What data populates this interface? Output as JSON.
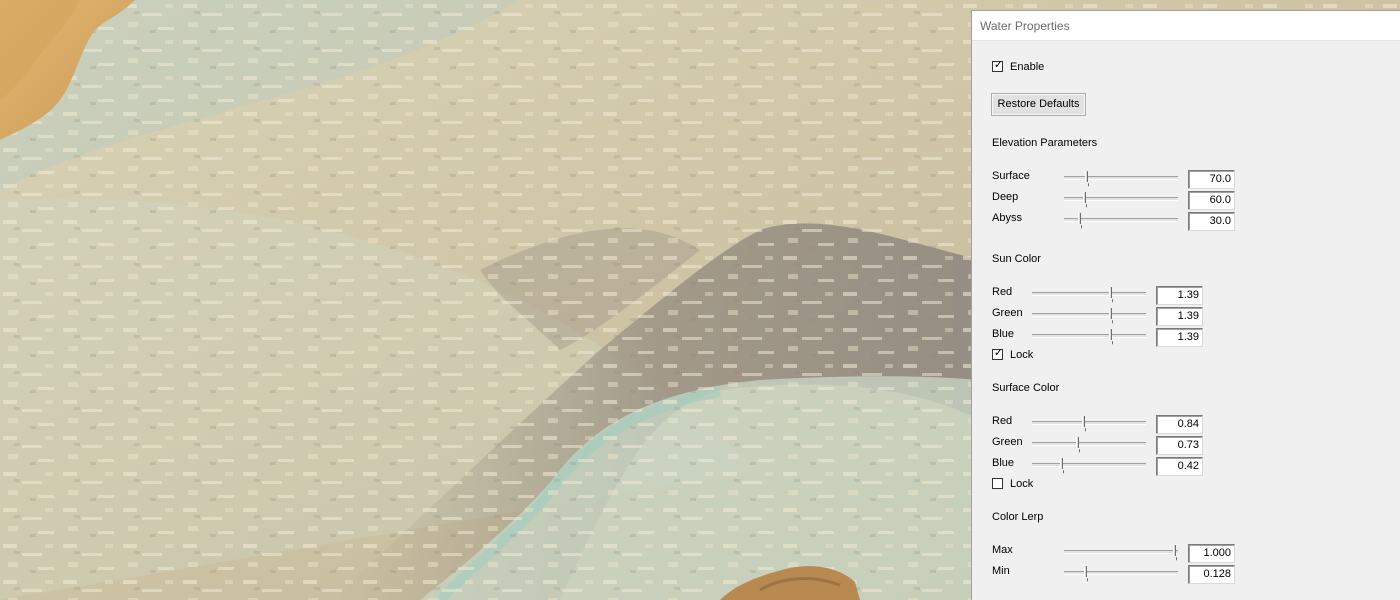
{
  "window": {
    "title": "Water Properties"
  },
  "enable": {
    "label": "Enable",
    "checked": true
  },
  "restore_button": {
    "label": "Restore Defaults"
  },
  "elevation": {
    "heading": "Elevation Parameters",
    "rows": [
      {
        "label": "Surface",
        "value": "70.0",
        "level": 0.17
      },
      {
        "label": "Deep",
        "value": "60.0",
        "level": 0.15
      },
      {
        "label": "Abyss",
        "value": "30.0",
        "level": 0.1
      }
    ]
  },
  "sun_color": {
    "heading": "Sun Color",
    "rows": [
      {
        "label": "Red",
        "value": "1.39",
        "level": 0.7
      },
      {
        "label": "Green",
        "value": "1.39",
        "level": 0.7
      },
      {
        "label": "Blue",
        "value": "1.39",
        "level": 0.7
      }
    ],
    "lock": {
      "label": "Lock",
      "checked": true
    }
  },
  "surface_color": {
    "heading": "Surface Color",
    "rows": [
      {
        "label": "Red",
        "value": "0.84",
        "level": 0.44
      },
      {
        "label": "Green",
        "value": "0.73",
        "level": 0.39
      },
      {
        "label": "Blue",
        "value": "0.42",
        "level": 0.24
      }
    ],
    "lock": {
      "label": "Lock",
      "checked": false
    }
  },
  "color_lerp": {
    "heading": "Color Lerp",
    "rows": [
      {
        "label": "Max",
        "value": "1.000",
        "level": 1.0
      },
      {
        "label": "Min",
        "value": "0.128",
        "level": 0.16
      }
    ]
  },
  "colors": {
    "sand": "#d9b06a",
    "shallow_water": "#d8ceb0",
    "deep_water": "#9a9183",
    "teal_edge": "#a9c6b4",
    "panel_bg": "#f0f0f0"
  }
}
